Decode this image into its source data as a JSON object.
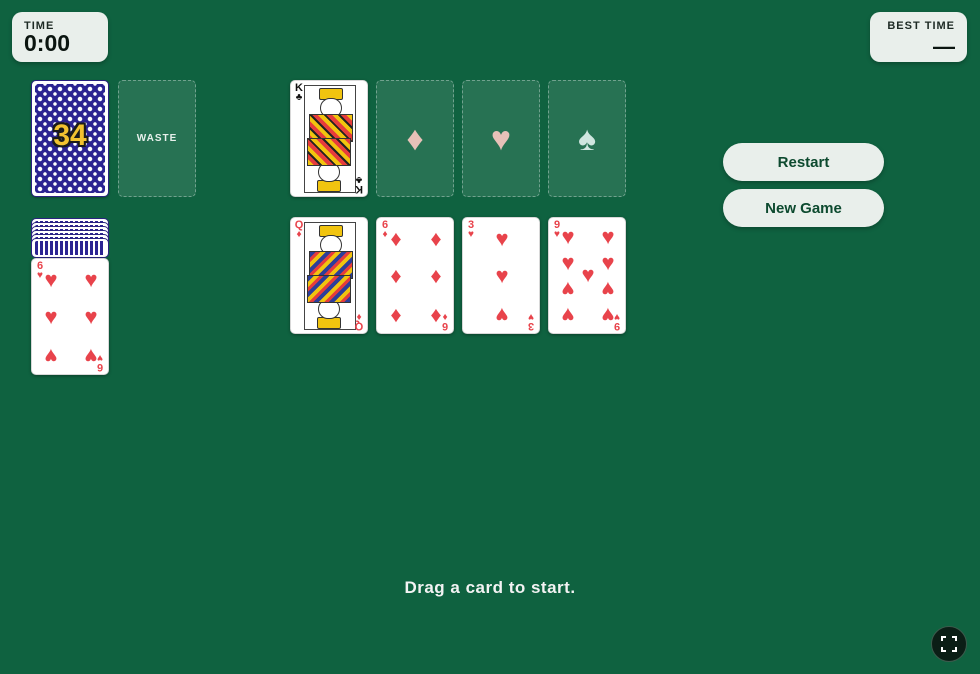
{
  "timer": {
    "label": "TIME",
    "value": "0:00"
  },
  "best_time": {
    "label": "BEST TIME",
    "value": "—"
  },
  "stock": {
    "count": "34"
  },
  "waste": {
    "label": "WASTE"
  },
  "foundations": [
    {
      "rank": "K",
      "suit": "♣",
      "filled": true
    },
    {
      "suit": "♦",
      "filled": false
    },
    {
      "suit": "♥",
      "filled": false
    },
    {
      "suit": "♠",
      "filled": false
    }
  ],
  "reserve": {
    "rank": "6",
    "suit": "♥"
  },
  "tableau": [
    {
      "rank": "Q",
      "suit": "♦"
    },
    {
      "rank": "6",
      "suit": "♦"
    },
    {
      "rank": "3",
      "suit": "♥"
    },
    {
      "rank": "9",
      "suit": "♥"
    }
  ],
  "buttons": {
    "restart": "Restart",
    "new_game": "New Game"
  },
  "status": "Drag a card to start.",
  "icons": {
    "fullscreen": "fullscreen-icon"
  },
  "colors": {
    "felt": "#0f6240",
    "red_suit": "#e8434b",
    "card_back": "#2b2392",
    "panel": "#e9efeb"
  }
}
